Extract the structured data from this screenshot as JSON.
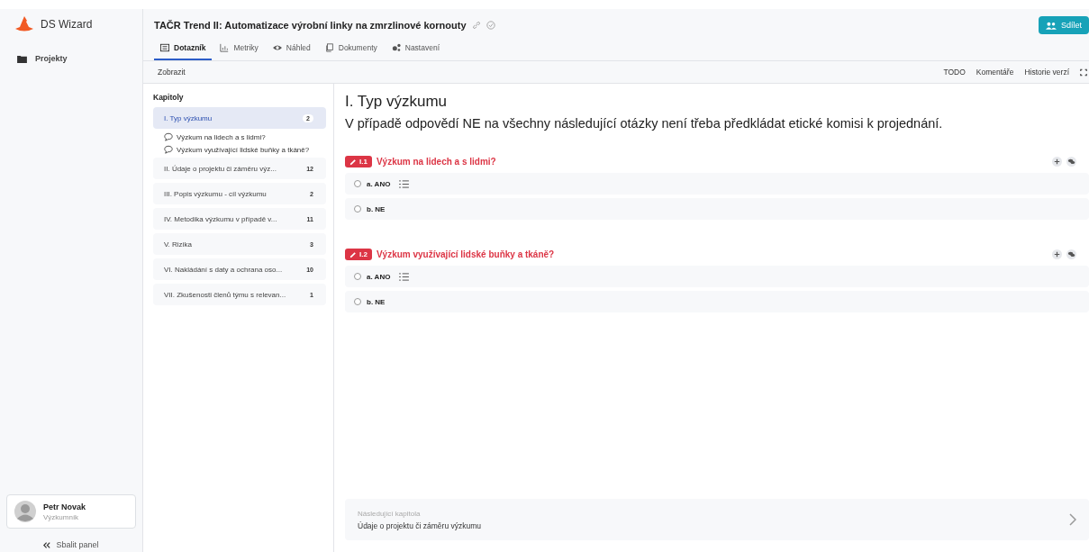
{
  "sidebar": {
    "app_name": "DS Wizard",
    "items": [
      {
        "label": "Projekty",
        "selected": false
      }
    ],
    "user": {
      "name": "Petr Novak",
      "role": "Výzkumník"
    },
    "collapse": "Sbalit panel"
  },
  "project": {
    "title": "TAČR Trend II: Automatizace výrobní linky na zmrzlinové kornouty",
    "share_button": "Sdílet"
  },
  "tabs": [
    {
      "label": "Dotazník",
      "selected": true
    },
    {
      "label": "Metriky",
      "selected": false
    },
    {
      "label": "Náhled",
      "selected": false
    },
    {
      "label": "Dokumenty",
      "selected": false
    },
    {
      "label": "Nastavení",
      "selected": false
    }
  ],
  "toolbar": {
    "left": "Zobrazit",
    "right": [
      "TODO",
      "Komentáře",
      "Historie verzí"
    ]
  },
  "chapters": {
    "heading": "Kapitoly",
    "items": [
      {
        "title": "I. Typ výzkumu",
        "count": "2",
        "selected": true,
        "children": [
          {
            "title": "Výzkum na lidech a s lidmi?"
          },
          {
            "title": "Výzkum využívající lidské buňky a tkáně?"
          }
        ]
      },
      {
        "title": "II. Údaje o projektu či záměru výz...",
        "count": "12",
        "selected": false
      },
      {
        "title": "III. Popis výzkumu - cíl výzkumu",
        "count": "2",
        "selected": false
      },
      {
        "title": "IV. Metodika výzkumu v případě v...",
        "count": "11",
        "selected": false
      },
      {
        "title": "V. Rizika",
        "count": "3",
        "selected": false
      },
      {
        "title": "VI. Nakládání s daty a ochrana oso...",
        "count": "10",
        "selected": false
      },
      {
        "title": "VII. Zkušenosti členů týmu s relevan...",
        "count": "1",
        "selected": false
      }
    ]
  },
  "content": {
    "title": "I. Typ výzkumu",
    "description": "V případě odpovědí NE na všechny následující otázky není třeba předkládat etické komisi k projednání.",
    "questions": [
      {
        "number": "I.1",
        "title": "Výzkum na lidech a s lidmi?",
        "answers": [
          {
            "label": "a. ANO",
            "selected": false,
            "followups": true
          },
          {
            "label": "b. NE",
            "selected": false,
            "followups": false
          }
        ]
      },
      {
        "number": "I.2",
        "title": "Výzkum využívající lidské buňky a tkáně?",
        "answers": [
          {
            "label": "a. ANO",
            "selected": false,
            "followups": true
          },
          {
            "label": "b. NE",
            "selected": false,
            "followups": false
          }
        ]
      }
    ],
    "next": {
      "label": "Následující kapitola",
      "title": "Údaje o projektu či záměru výzkumu"
    }
  }
}
